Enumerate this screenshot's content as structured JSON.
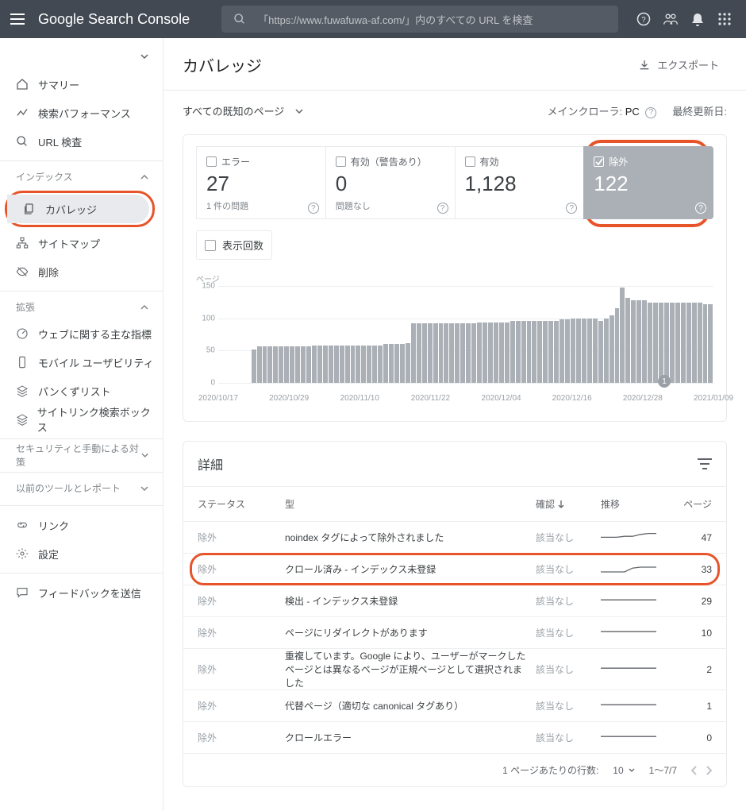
{
  "appbar": {
    "title_google": "Google",
    "title_sc": "Search Console",
    "search_placeholder": "「https://www.fuwafuwa-af.com/」内のすべての URL を検査"
  },
  "sidebar": {
    "summary": "サマリー",
    "performance": "検索パフォーマンス",
    "url_inspect": "URL 検査",
    "index_section": "インデックス",
    "coverage": "カバレッジ",
    "sitemaps": "サイトマップ",
    "removals": "削除",
    "enhance_section": "拡張",
    "cwv": "ウェブに関する主な指標",
    "mobile": "モバイル ユーザビリティ",
    "breadcrumb": "パンくずリスト",
    "sitelinks": "サイトリンク検索ボックス",
    "security_section": "セキュリティと手動による対策",
    "legacy_section": "以前のツールとレポート",
    "links": "リンク",
    "settings": "設定",
    "feedback": "フィードバックを送信"
  },
  "page": {
    "title": "カバレッジ",
    "export": "エクスポート",
    "filter": "すべての既知のページ",
    "crawler_label": "メインクローラ:",
    "crawler_value": "PC",
    "updated_label": "最終更新日:"
  },
  "cards": [
    {
      "label": "エラー",
      "value": "27",
      "sub": "1 件の問題"
    },
    {
      "label": "有効（警告あり）",
      "value": "0",
      "sub": "問題なし"
    },
    {
      "label": "有効",
      "value": "1,128",
      "sub": ""
    },
    {
      "label": "除外",
      "value": "122",
      "sub": ""
    }
  ],
  "impressions_label": "表示回数",
  "chart_axis_label": "ページ",
  "chart_data": {
    "type": "bar",
    "ylabel": "ページ",
    "ylim": [
      0,
      150
    ],
    "yticks": [
      0,
      50,
      100,
      150
    ],
    "x_ticks": [
      "2020/10/17",
      "2020/10/29",
      "2020/11/10",
      "2020/11/22",
      "2020/12/04",
      "2020/12/16",
      "2020/12/28",
      "2021/01/09"
    ],
    "values": [
      0,
      0,
      0,
      0,
      0,
      0,
      52,
      56,
      56,
      56,
      56,
      56,
      56,
      56,
      56,
      56,
      56,
      58,
      58,
      58,
      58,
      58,
      58,
      58,
      58,
      58,
      58,
      58,
      58,
      58,
      60,
      60,
      60,
      60,
      62,
      92,
      92,
      92,
      92,
      92,
      92,
      92,
      92,
      92,
      92,
      92,
      92,
      94,
      94,
      94,
      94,
      94,
      94,
      96,
      96,
      96,
      96,
      96,
      96,
      96,
      96,
      96,
      98,
      98,
      100,
      100,
      100,
      100,
      100,
      96,
      100,
      104,
      116,
      148,
      132,
      128,
      128,
      128,
      124,
      124,
      124,
      124,
      124,
      124,
      124,
      124,
      124,
      124,
      122,
      122
    ]
  },
  "details": {
    "title": "詳細",
    "headers": {
      "status": "ステータス",
      "type": "型",
      "conf": "確認",
      "trend": "推移",
      "pages": "ページ"
    },
    "rows": [
      {
        "status": "除外",
        "type": "noindex タグによって除外されました",
        "conf": "該当なし",
        "spark": [
          8,
          8,
          8,
          9,
          9,
          11,
          12,
          12
        ],
        "pages": "47"
      },
      {
        "status": "除外",
        "type": "クロール済み - インデックス未登録",
        "conf": "該当なし",
        "spark": [
          5,
          5,
          5,
          5,
          9,
          10,
          10,
          10
        ],
        "pages": "33",
        "highlight": true
      },
      {
        "status": "除外",
        "type": "検出 - インデックス未登録",
        "conf": "該当なし",
        "spark": [
          9,
          9,
          9,
          9,
          9,
          9,
          9,
          9
        ],
        "pages": "29"
      },
      {
        "status": "除外",
        "type": "ページにリダイレクトがあります",
        "conf": "該当なし",
        "spark": [
          9,
          9,
          9,
          9,
          9,
          9,
          9,
          9
        ],
        "pages": "10"
      },
      {
        "status": "除外",
        "type": "重複しています。Google により、ユーザーがマークしたページとは異なるページが正規ページとして選択されました",
        "conf": "該当なし",
        "spark": [
          9,
          9,
          9,
          9,
          9,
          9,
          9,
          9
        ],
        "pages": "2"
      },
      {
        "status": "除外",
        "type": "代替ページ（適切な canonical タグあり）",
        "conf": "該当なし",
        "spark": [
          9,
          9,
          9,
          9,
          9,
          9,
          9,
          9
        ],
        "pages": "1"
      },
      {
        "status": "除外",
        "type": "クロールエラー",
        "conf": "該当なし",
        "spark": [
          9,
          9,
          9,
          9,
          9,
          9,
          9,
          9
        ],
        "pages": "0"
      }
    ],
    "pager": {
      "rows_label": "1 ページあたりの行数:",
      "rows_value": "10",
      "range": "1～7/7"
    }
  }
}
